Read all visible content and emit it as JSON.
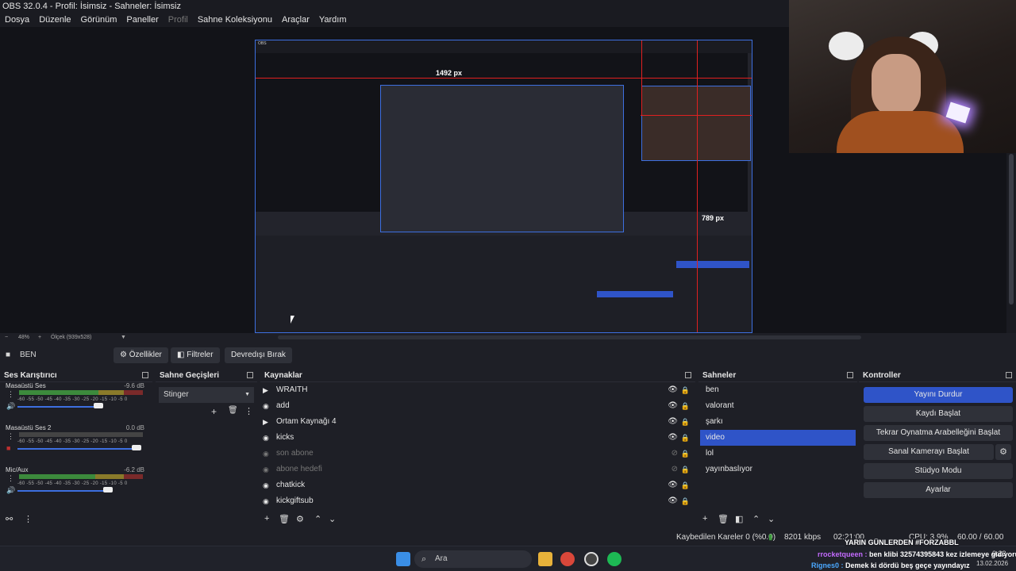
{
  "window": {
    "title": "OBS 32.0.4 - Profil: İsimsiz - Sahneler: İsimsiz"
  },
  "menu": [
    "Dosya",
    "Düzenle",
    "Görünüm",
    "Paneller",
    "Profil",
    "Sahne Koleksiyonu",
    "Araçlar",
    "Yardım"
  ],
  "preview": {
    "measure_a": "1492 px",
    "measure_b": "789 px",
    "zoom_text": "48%",
    "scale_text": "Ölçek (939x528)"
  },
  "source_toolbar": {
    "scene_name": "BEN",
    "properties": "Özellikler",
    "filters": "Filtreler",
    "deactivate": "Devredışı Bırak"
  },
  "mixer": {
    "title": "Ses Karıştırıcı",
    "channels": [
      {
        "name": "Masaüstü Ses",
        "db": "-9.6 dB",
        "level": 0.72
      },
      {
        "name": "Masaüstü Ses 2",
        "db": "0.0 dB",
        "level": 0.0
      },
      {
        "name": "Mic/Aux",
        "db": "-6.2 dB",
        "level": 0.64
      }
    ],
    "scale": "-60 -55 -50 -45 -40 -35 -30 -25 -20 -15 -10 -5 0"
  },
  "transitions": {
    "title": "Sahne Geçişleri",
    "selected": "Stinger"
  },
  "sources": {
    "title": "Kaynaklar",
    "items": [
      {
        "label": "WRAITH",
        "visible": true,
        "dim": false
      },
      {
        "label": "add",
        "visible": true,
        "dim": false
      },
      {
        "label": "Ortam Kaynağı 4",
        "visible": true,
        "dim": false
      },
      {
        "label": "kicks",
        "visible": true,
        "dim": false
      },
      {
        "label": "son abone",
        "visible": false,
        "dim": true
      },
      {
        "label": "abone hedefi",
        "visible": false,
        "dim": true
      },
      {
        "label": "chatkick",
        "visible": true,
        "dim": false
      },
      {
        "label": "kickgiftsub",
        "visible": true,
        "dim": false
      }
    ]
  },
  "scenes": {
    "title": "Sahneler",
    "items": [
      "ben",
      "valorant",
      "şarkı",
      "video",
      "lol",
      "yayınbaslıyor"
    ],
    "selected_index": 3
  },
  "controls": {
    "title": "Kontroller",
    "buttons": [
      "Yayını Durdur",
      "Kaydı Başlat",
      "Tekrar Oynatma Arabelleğini Başlat",
      "Sanal Kamerayı Başlat",
      "Stüdyo Modu",
      "Ayarlar"
    ]
  },
  "status": {
    "dropped": "Kaybedilen Kareler 0 (%0.0)",
    "bitrate": "8201 kbps",
    "time": "02:21:00",
    "cpu": "CPU: 3.9%",
    "fps": "60.00 / 60.00 FPS"
  },
  "overlay_text": {
    "banner": "YARIN GÜNLERDEN #FORZABBL",
    "chat1_user": "rrocketqueen :",
    "chat1_msg": "ben klibi 32574395843 kez izlemeye gidiyorum",
    "chat2_user": "Rignes0 :",
    "chat2_msg": "Demek ki dördü beş geçe yayındayız"
  },
  "taskbar": {
    "search": "Ara",
    "clock_time": "0:23",
    "clock_date": "13.02.2026"
  },
  "colors": {
    "accent": "#2f54c8",
    "selection": "#2f54c8",
    "guide": "#e02020"
  }
}
